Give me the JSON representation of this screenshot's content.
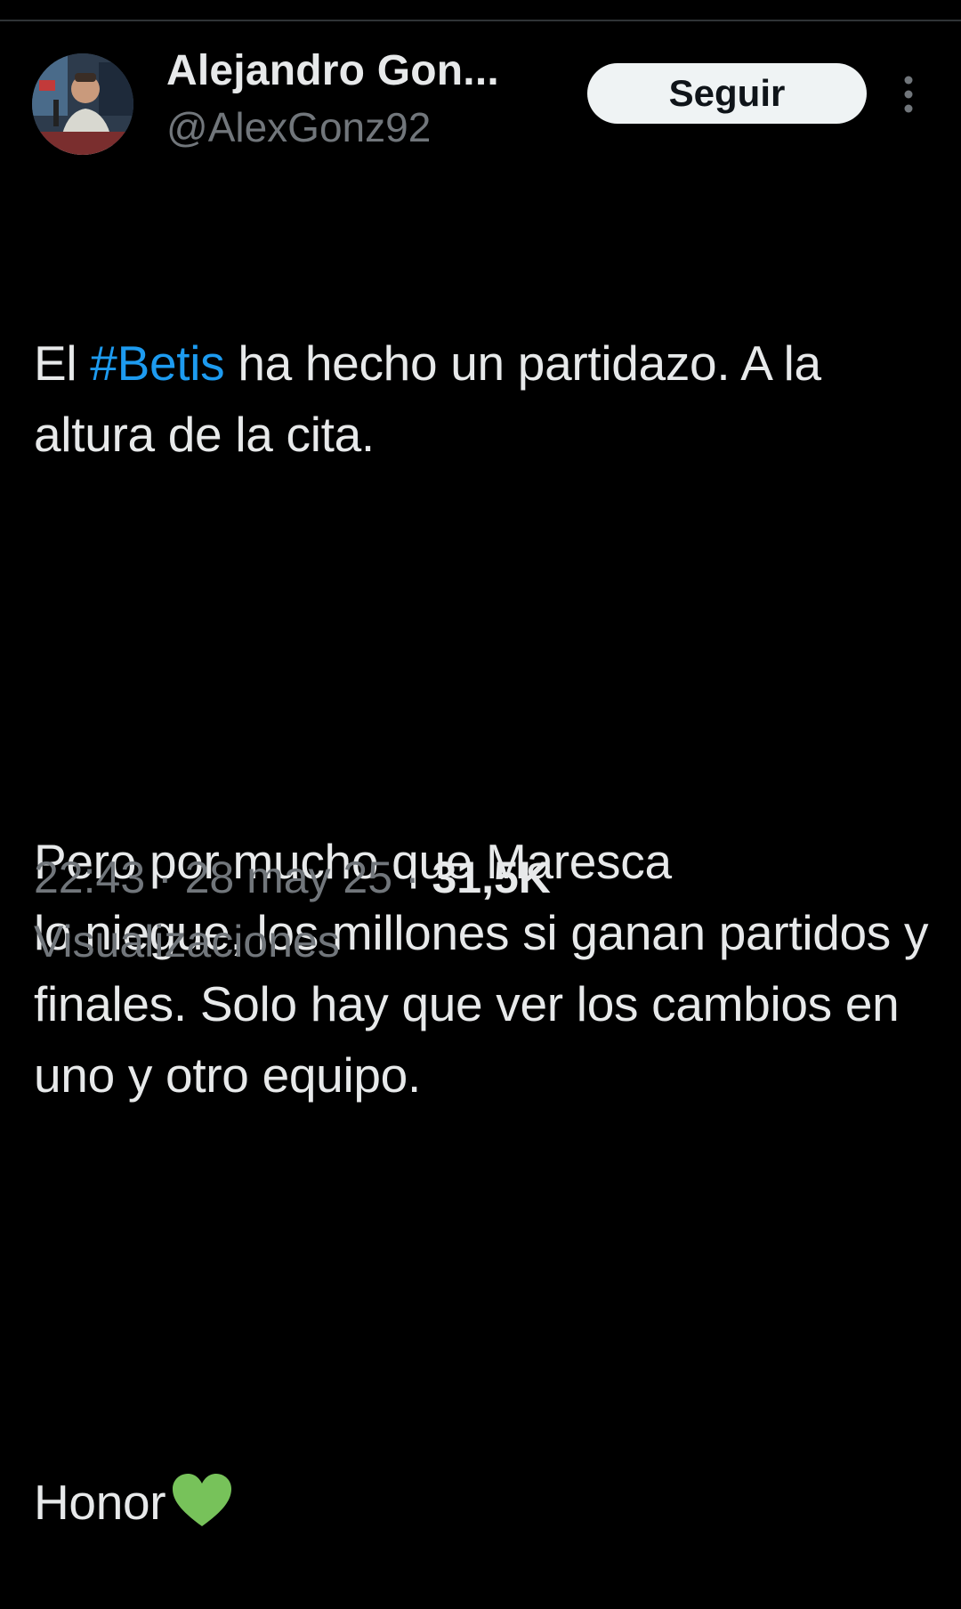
{
  "tweet": {
    "author": {
      "display_name": "Alejandro Gon...",
      "handle": "@AlexGonz92"
    },
    "follow_label": "Seguir",
    "text": {
      "line1_prefix": "El ",
      "hashtag": "#Betis",
      "line1_suffix": " ha hecho un partidazo. A la altura de la cita.",
      "paragraph2": "Pero por mucho que Maresca\nlo niegue, los millones si ganan partidos y finales. Solo hay que ver los cambios en uno y otro equipo.",
      "paragraph3": "Honor",
      "emoji": "green-heart"
    },
    "meta": {
      "time": "22:43",
      "separator": " · ",
      "date": "28 may 25",
      "views": "31,5K",
      "views_label": "Visualizaciones"
    }
  },
  "colors": {
    "background": "#000000",
    "text": "#e7e9ea",
    "muted": "#71767b",
    "link": "#1d9bf0",
    "button_bg": "#eff3f4",
    "heart": "#77c25a"
  }
}
